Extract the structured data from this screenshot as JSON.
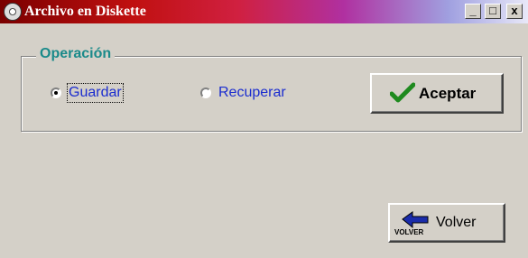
{
  "window": {
    "title": "Archivo en Diskette",
    "buttons": {
      "minimize": "_",
      "maximize": "□",
      "close": "x"
    }
  },
  "operacion": {
    "group_label": "Operación",
    "options": [
      {
        "label": "Guardar",
        "selected": true
      },
      {
        "label": "Recuperar",
        "selected": false
      }
    ]
  },
  "buttons": {
    "aceptar": {
      "label": "Aceptar",
      "icon": "checkmark-icon"
    },
    "volver": {
      "label": "Volver",
      "icon_caption": "VOLVER",
      "icon": "back-arrow-icon"
    }
  },
  "colors": {
    "label_blue": "#1a2ccf",
    "group_teal": "#1a8a8a",
    "face": "#d4d0c8"
  }
}
